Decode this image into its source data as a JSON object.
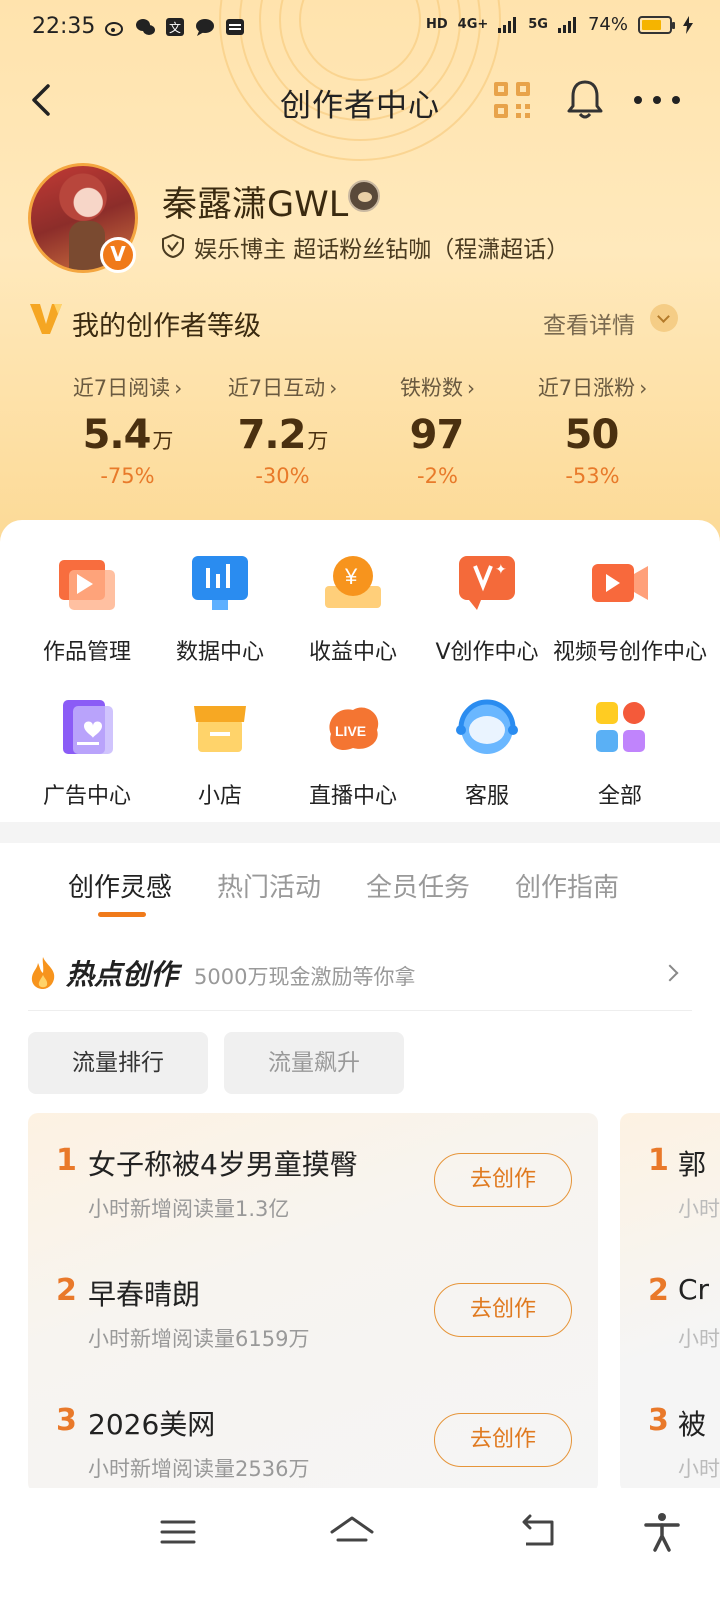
{
  "status_bar": {
    "time": "22:35",
    "network_1": "4G+",
    "network_2": "5G",
    "battery": "74%",
    "battery_level": 0.74
  },
  "nav": {
    "title": "创作者中心",
    "icons": [
      "back-arrow-icon",
      "qr-code-icon",
      "bell-icon",
      "more-icon"
    ]
  },
  "profile": {
    "username": "秦露潇GWL",
    "tag": "娱乐博主 超话粉丝钻咖（程潇超话）"
  },
  "level": {
    "title": "我的创作者等级",
    "detail": "查看详情"
  },
  "stats": [
    {
      "label": "近7日阅读",
      "value": "5.4",
      "unit": "万",
      "change": "-75%"
    },
    {
      "label": "近7日互动",
      "value": "7.2",
      "unit": "万",
      "change": "-30%"
    },
    {
      "label": "铁粉数",
      "value": "97",
      "unit": "",
      "change": "-2%"
    },
    {
      "label": "近7日涨粉",
      "value": "50",
      "unit": "",
      "change": "-53%"
    }
  ],
  "services": [
    {
      "label": "作品管理",
      "icon": "works-icon"
    },
    {
      "label": "数据中心",
      "icon": "data-icon"
    },
    {
      "label": "收益中心",
      "icon": "income-icon"
    },
    {
      "label": "V创作中心",
      "icon": "v-create-icon"
    },
    {
      "label": "视频号创作中心",
      "icon": "video-icon"
    },
    {
      "label": "广告中心",
      "icon": "ad-icon"
    },
    {
      "label": "小店",
      "icon": "shop-icon"
    },
    {
      "label": "直播中心",
      "icon": "live-icon"
    },
    {
      "label": "客服",
      "icon": "service-icon"
    },
    {
      "label": "全部",
      "icon": "all-icon"
    }
  ],
  "tabs": [
    "创作灵感",
    "热门活动",
    "全员任务",
    "创作指南"
  ],
  "hot": {
    "title": "热点创作",
    "subtitle": "5000万现金激励等你拿"
  },
  "chips": [
    "流量排行",
    "流量飙升"
  ],
  "trending": [
    {
      "rank": "1",
      "topic": "女子称被4岁男童摸臀",
      "metric": "小时新增阅读量1.3亿",
      "button": "去创作"
    },
    {
      "rank": "2",
      "topic": "早春晴朗",
      "metric": "小时新增阅读量6159万",
      "button": "去创作"
    },
    {
      "rank": "3",
      "topic": "2026美网",
      "metric": "小时新增阅读量2536万",
      "button": "去创作"
    }
  ],
  "trending_2": [
    {
      "rank": "1",
      "topic": "郭",
      "metric": "小时"
    },
    {
      "rank": "2",
      "topic": "Cr",
      "metric": "小时"
    },
    {
      "rank": "3",
      "topic": "被",
      "metric": "小时"
    }
  ]
}
